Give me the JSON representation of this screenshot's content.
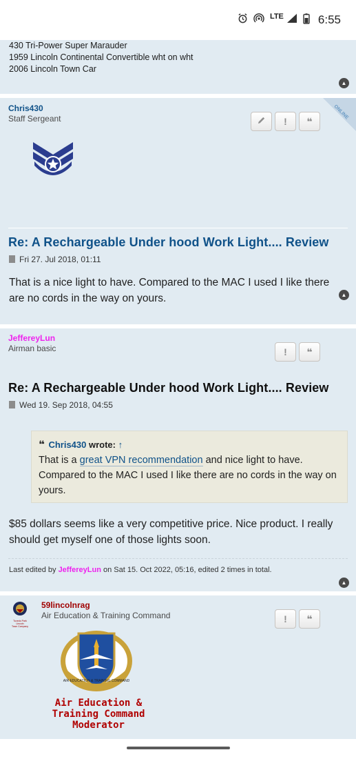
{
  "status_bar": {
    "time": "6:55",
    "network": "LTE"
  },
  "top_post": {
    "signature_lines": [
      "430 Tri-Power Super Marauder",
      "1959 Lincoln Continental Convertible wht on wht",
      "2006 Lincoln Town Car"
    ]
  },
  "post1": {
    "author": "Chris430",
    "rank": "Staff Sergeant",
    "online_label": "ONLINE",
    "title": "Re: A Rechargeable Under hood Work Light.... Review",
    "date": "Fri 27. Jul 2018, 01:11",
    "body": "That is a nice light to have. Compared to the MAC I used I like there are no cords in the way on yours."
  },
  "post2": {
    "author": "JeffereyLun",
    "rank": "Airman basic",
    "title": "Re: A Rechargeable Under hood Work Light.... Review",
    "date": "Wed 19. Sep 2018, 04:55",
    "quote": {
      "author": "Chris430",
      "wrote": "wrote:",
      "arrow": "↑",
      "text_before": "That is a ",
      "link_text": "great VPN recommendation",
      "text_after": " and nice light to have. Compared to the MAC I used I like there are no cords in the way on yours."
    },
    "body": "$85 dollars seems like a very competitive price. Nice product. I really should get myself one of those lights soon.",
    "edit_note": {
      "prefix": "Last edited by",
      "editor": "JeffereyLun",
      "suffix": "on Sat 15. Oct 2022, 05:16, edited 2 times in total."
    }
  },
  "post3": {
    "author": "59lincolnrag",
    "rank": "Air Education & Training Command",
    "rank_image_lines": [
      "Air Education &",
      "Training Command",
      "Moderator"
    ],
    "avatar_caption_lines": [
      "Tuxedo Park Lincoln",
      "Town Company"
    ],
    "emblem_ring_text": "AIR EDUCATION & TRAINING COMMAND"
  },
  "icons": {
    "edit": "pencil-icon",
    "report": "exclamation-icon",
    "quote": "quote-icon",
    "top": "chevron-up-icon",
    "doc": "document-icon"
  },
  "colors": {
    "post_bg": "#e1ebf2",
    "link": "#105289",
    "pink_user": "#ee22ee",
    "quote_bg": "#ebeadd"
  }
}
